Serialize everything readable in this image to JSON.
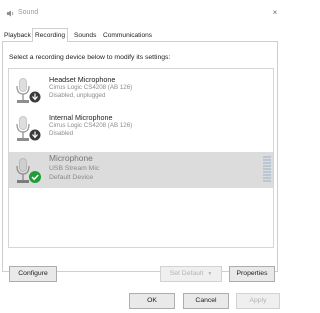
{
  "window": {
    "title": "Sound",
    "close_glyph": "×"
  },
  "tabs": [
    {
      "label": "Playback"
    },
    {
      "label": "Recording"
    },
    {
      "label": "Sounds"
    },
    {
      "label": "Communications"
    }
  ],
  "instruction": "Select a recording device below to modify its settings:",
  "devices": [
    {
      "name": "Headset Microphone",
      "line1": "Cirrus Logic CS4208 (AB 126)",
      "line2": "Disabled, unplugged",
      "icon": "headset-microphone-icon",
      "status_icon": "disabled-arrow-icon"
    },
    {
      "name": "Internal Microphone",
      "line1": "Cirrus Logic CS4208 (AB 126)",
      "line2": "Disabled",
      "icon": "internal-microphone-icon",
      "status_icon": "disabled-arrow-icon"
    },
    {
      "name": "Microphone",
      "line1": "USB Stream Mic",
      "line2": "Default Device",
      "icon": "usb-microphone-icon",
      "status_icon": "default-checkmark-icon",
      "selected": true
    }
  ],
  "buttons": {
    "configure": "Configure",
    "set_default": "Set Default",
    "properties": "Properties",
    "ok": "OK",
    "cancel": "Cancel",
    "apply": "Apply"
  },
  "colors": {
    "selection": "#dcdcdc",
    "default_badge": "#1f9d3a",
    "level_meter": "#b9c6d6"
  }
}
